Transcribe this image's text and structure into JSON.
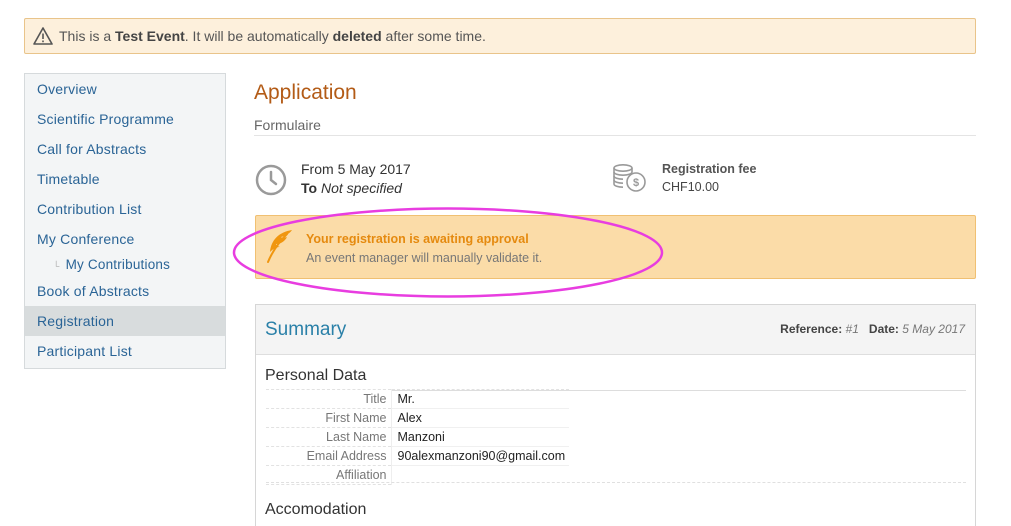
{
  "banner": {
    "prefix": "This is a ",
    "strong1": "Test Event",
    "middle": ". It will be automatically ",
    "strong2": "deleted",
    "suffix": " after some time.",
    "icon": "warning-triangle-icon"
  },
  "sidebar": {
    "items": [
      {
        "label": "Overview"
      },
      {
        "label": "Scientific Programme"
      },
      {
        "label": "Call for Abstracts"
      },
      {
        "label": "Timetable"
      },
      {
        "label": "Contribution List"
      },
      {
        "label": "My Conference"
      },
      {
        "label": "My Contributions"
      },
      {
        "label": "Book of Abstracts"
      },
      {
        "label": "Registration"
      },
      {
        "label": "Participant List"
      }
    ],
    "active": "Registration"
  },
  "page": {
    "title": "Application",
    "subtitle": "Formulaire"
  },
  "info": {
    "date_from_label": "From",
    "date_from": "5 May 2017",
    "date_to_label": "To",
    "date_to": "Not specified",
    "fee_label": "Registration fee",
    "fee_value": "CHF10.00"
  },
  "approval": {
    "title": "Your registration is awaiting approval",
    "body": "An event manager will manually validate it."
  },
  "summary": {
    "title": "Summary",
    "reference_label": "Reference:",
    "reference_value": "#1",
    "date_label": "Date:",
    "date_value": "5 May 2017",
    "personal_title": "Personal Data",
    "fields": [
      {
        "key": "Title",
        "value": "Mr."
      },
      {
        "key": "First Name",
        "value": "Alex"
      },
      {
        "key": "Last Name",
        "value": "Manzoni"
      },
      {
        "key": "Email Address",
        "value": "90alexmanzoni90@gmail.com"
      },
      {
        "key": "Affiliation",
        "value": ""
      }
    ],
    "accommodation_title": "Accomodation"
  },
  "colors": {
    "accent_title": "#b35b16",
    "link": "#2a6496",
    "summary_title": "#2a80a8",
    "approval_bg": "#fbdca8",
    "approval_title": "#e58a0f",
    "highlight": "#e83de0"
  }
}
